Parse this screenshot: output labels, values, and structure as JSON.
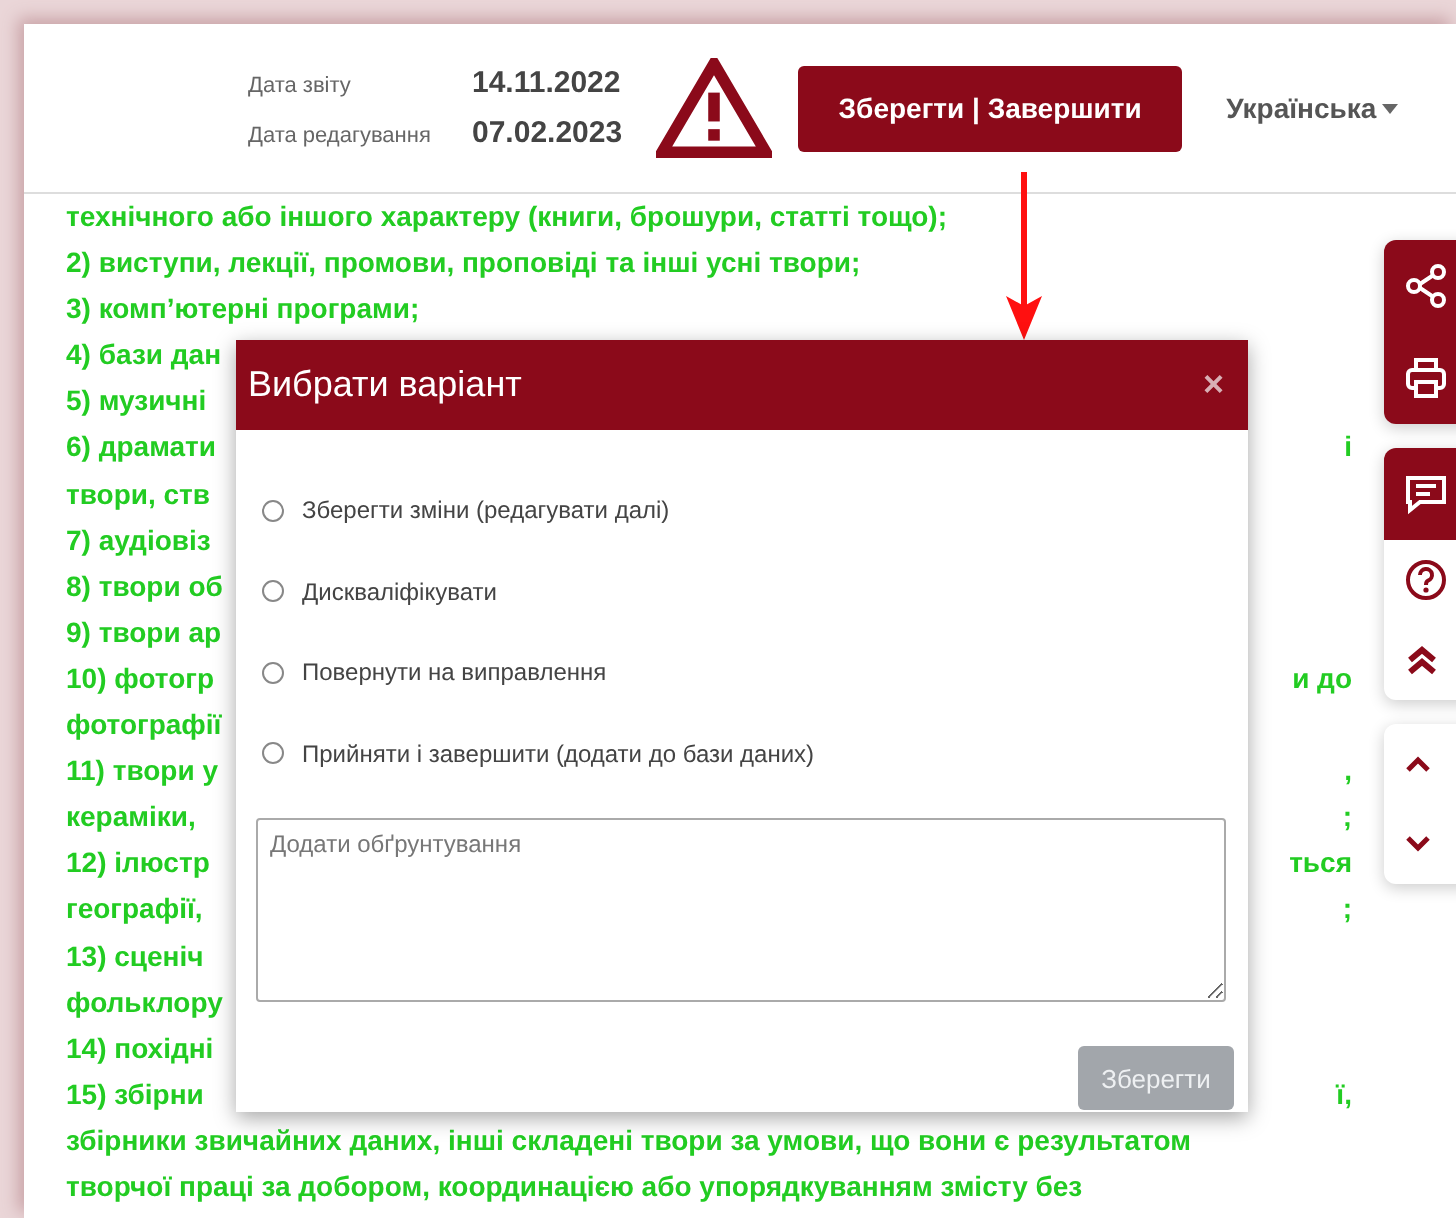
{
  "header": {
    "report_date_label": "Дата звіту",
    "report_date": "14.11.2022",
    "edit_date_label": "Дата редагування",
    "edit_date": "07.02.2023",
    "save_finish_button": "Зберегти | Завершити",
    "language": "Українська"
  },
  "document_lines": [
    {
      "left": "технічного або іншого характеру (книги, брошури, статті тощо);"
    },
    {
      "left": "2) виступи, лекції, промови, проповіді та інші усні твори;"
    },
    {
      "left": "3) комп’ютерні програми;"
    },
    {
      "left": "4) бази дан"
    },
    {
      "left": "5) музичні"
    },
    {
      "left": "6) драмати",
      "right": "і"
    },
    {
      "left": "твори, ств"
    },
    {
      "left": "7) аудіовіз"
    },
    {
      "left": "8) твори об"
    },
    {
      "left": "9) твори ар"
    },
    {
      "left": "10) фотогр",
      "right": "и до"
    },
    {
      "left": "фотографії"
    },
    {
      "left": "11) твори у",
      "right": ","
    },
    {
      "left": "кераміки,",
      "right": ";"
    },
    {
      "left": "12) ілюстр",
      "right": "ться"
    },
    {
      "left": "географії,",
      "right": ";"
    },
    {
      "left": "13) сценіч"
    },
    {
      "left": "фольклору"
    },
    {
      "left": "14) похідні"
    },
    {
      "left": "15) збірни",
      "right": "ї,"
    },
    {
      "left": "збірники звичайних даних, інші складені твори за умови, що вони є результатом"
    },
    {
      "left": "творчої праці за добором, координацією або упорядкуванням змісту без"
    }
  ],
  "dialog": {
    "title": "Вибрати варіант",
    "close": "×",
    "options": [
      {
        "label": "Зберегти зміни (редагувати далі)",
        "selected": false
      },
      {
        "label": "Дискваліфікувати",
        "selected": false
      },
      {
        "label": "Повернути на виправлення",
        "selected": false
      },
      {
        "label": "Прийняти і завершити (додати до бази даних)",
        "selected": false
      }
    ],
    "justification": {
      "placeholder": "Додати обґрунтування"
    },
    "save_button": {
      "label": "Зберегти",
      "disabled": true
    }
  }
}
